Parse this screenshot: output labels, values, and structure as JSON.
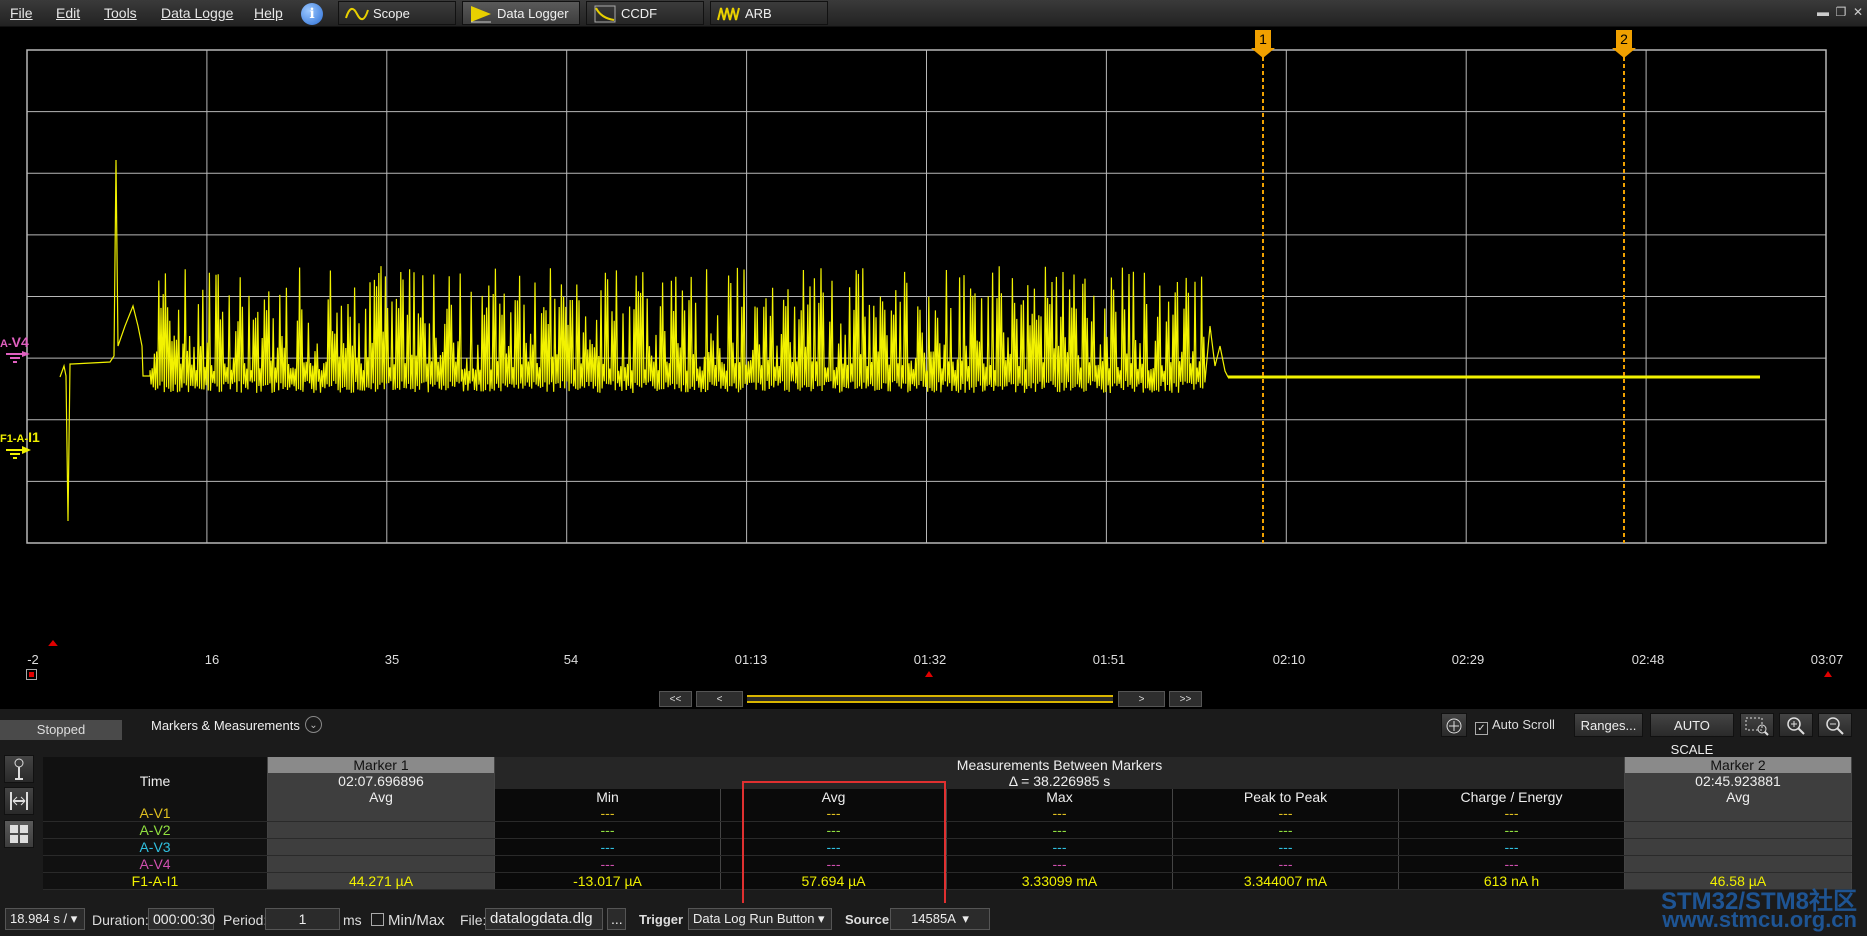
{
  "menu": {
    "file": "File",
    "edit": "Edit",
    "tools": "Tools",
    "data_logger": "Data Logge",
    "help": "Help"
  },
  "tabs": [
    {
      "label": "Scope",
      "icon": "sine-wave-icon"
    },
    {
      "label": "Data Logger",
      "icon": "data-logger-icon"
    },
    {
      "label": "CCDF",
      "icon": "ccdf-icon"
    },
    {
      "label": "ARB",
      "icon": "arb-wave-icon"
    }
  ],
  "plot": {
    "channels": [
      {
        "name": "A-V4",
        "prefix": "A-",
        "suffix": "V4",
        "color": "#e060c0"
      },
      {
        "name": "F1-A-I1",
        "prefix": "F1-A-",
        "suffix": "I1",
        "color": "#f0f000"
      }
    ],
    "x_ticks": [
      "-2",
      "16",
      "35",
      "54",
      "01:13",
      "01:32",
      "01:51",
      "02:10",
      "02:29",
      "02:48",
      "03:07"
    ],
    "markers": [
      {
        "label": "1",
        "color": "#f0a000"
      },
      {
        "label": "2",
        "color": "#f0a000"
      }
    ],
    "trace_color": "#f2f200",
    "grid_color": "#b8b8b8"
  },
  "nav": {
    "first": "<<",
    "prev": "<",
    "next": ">",
    "last": ">>"
  },
  "panel": {
    "status": "Stopped",
    "title": "Markers & Measurements",
    "auto_scroll": "Auto Scroll",
    "ranges": "Ranges...",
    "auto_scale": "AUTO SCALE"
  },
  "table": {
    "time_label": "Time",
    "marker1_header": "Marker 1",
    "marker1_time": "02:07.696896",
    "between_header": "Measurements Between Markers",
    "delta": "Δ = 38.226985 s",
    "marker2_header": "Marker 2",
    "marker2_time": "02:45.923881",
    "columns": [
      "Avg",
      "Min",
      "Avg",
      "Max",
      "Peak to Peak",
      "Charge / Energy",
      "Avg"
    ],
    "rows": [
      {
        "label": "A-V1",
        "color": "#e0c020",
        "values": [
          "",
          "---",
          "---",
          "---",
          "---",
          "---",
          ""
        ]
      },
      {
        "label": "A-V2",
        "color": "#90e040",
        "values": [
          "",
          "---",
          "---",
          "---",
          "---",
          "---",
          ""
        ]
      },
      {
        "label": "A-V3",
        "color": "#30c0e0",
        "values": [
          "",
          "---",
          "---",
          "---",
          "---",
          "---",
          ""
        ]
      },
      {
        "label": "A-V4",
        "color": "#d050b0",
        "values": [
          "",
          "---",
          "---",
          "---",
          "---",
          "---",
          ""
        ]
      },
      {
        "label": "F1-A-I1",
        "color": "#f0f000",
        "values": [
          "44.271 µA",
          "-13.017 µA",
          "57.694 µA",
          "3.33099 mA",
          "3.344007 mA",
          "613 nA h",
          "46.58 µA"
        ]
      }
    ]
  },
  "statusbar": {
    "timebase": "18.984 s /",
    "duration_label": "Duration:",
    "duration": "000:00:30",
    "period_label": "Period:",
    "period": "1",
    "period_unit": "ms",
    "minmax": "Min/Max",
    "file_label": "File:",
    "file": "datalogdata.dlg",
    "browse": "...",
    "trigger_label": "Trigger",
    "trigger": "Data Log Run Button",
    "source_label": "Source",
    "source": "14585A"
  },
  "watermark": {
    "line1": "STM32/STM8社区",
    "line2": "www.stmcu.org.cn"
  }
}
